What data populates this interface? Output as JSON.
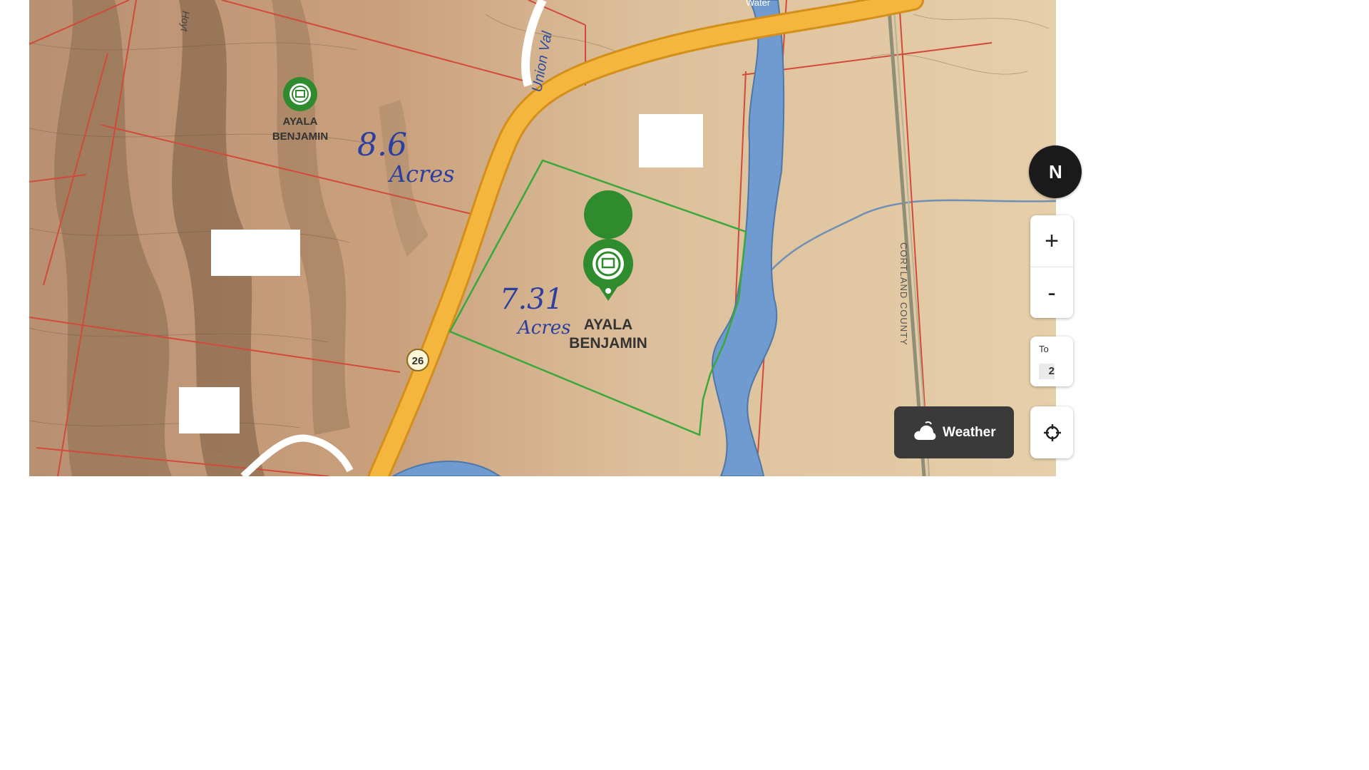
{
  "map": {
    "owner_labels": [
      {
        "line1": "AYALA",
        "line2": "BENJAMIN"
      },
      {
        "line1": "AYALA",
        "line2": "BENJAMIN"
      }
    ],
    "annotations": {
      "acres_left_number": "8.6",
      "acres_left_unit": "Acres",
      "acres_right_number": "7.31",
      "acres_right_unit": "Acres"
    },
    "road_labels": {
      "route_shield": "26",
      "union_valley": "Union Val",
      "left_road": "Hoyt",
      "top_road": "Water",
      "county_line": "CORTLAND COUNTY"
    }
  },
  "controls": {
    "compass_letter": "N",
    "zoom_in": "+",
    "zoom_out": "-",
    "terrain_label": "To",
    "terrain_count": "2",
    "weather_label": "Weather"
  },
  "colors": {
    "terrain": "#d9b78f",
    "hillshade": "#8a6b4e",
    "parcel_lines": "#d24a3a",
    "road": "#f4b63c",
    "river": "#6f9bd0",
    "selected_parcel": "#3aa83a",
    "owner_pin": "#2e8b2e"
  },
  "icons": [
    "owner-pin-icon",
    "cloud-icon",
    "crosshair-icon",
    "compass-icon"
  ]
}
